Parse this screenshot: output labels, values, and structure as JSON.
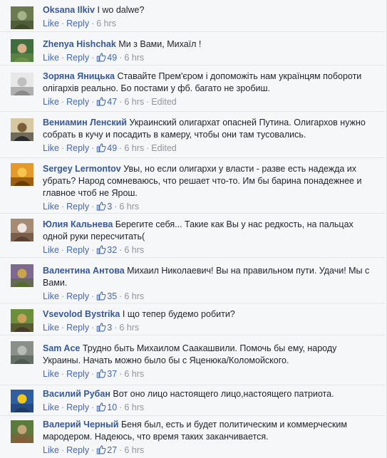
{
  "actions": {
    "like": "Like",
    "reply": "Reply",
    "sep": "·",
    "edited": "Edited"
  },
  "comments": [
    {
      "author": "Oksana Ilkiv",
      "text": "I wo dalwe?",
      "likes": "",
      "time": "6 hrs",
      "edited": false
    },
    {
      "author": "Zhenya Hishchak",
      "text": "Ми з Вами, Михаїл !",
      "likes": "49",
      "time": "6 hrs",
      "edited": false
    },
    {
      "author": "Зоряна Яницька",
      "text": "Ставайте Прем'єром і допоможіть нам українцям побороти олігархів реально. Бо постами у фб. багато не зробиш.",
      "likes": "47",
      "time": "6 hrs",
      "edited": true
    },
    {
      "author": "Вениамин Ленский",
      "text": "Украинский олигархат опасней Путина. Олигархов нужно собрать в кучу и посадить в камеру, чтобы они там тусовались.",
      "likes": "49",
      "time": "6 hrs",
      "edited": true
    },
    {
      "author": "Sergey Lermontov",
      "text": "Увы, но если олигархи у власти - разве есть надежда их убрать? Народ сомневаюсь, что решает что-то. Им бы барина понадежнее и главное чтоб не Ярош.",
      "likes": "3",
      "time": "6 hrs",
      "edited": false
    },
    {
      "author": "Юлия Кальнева",
      "text": "Берегите себя... Такие как Вы у нас редкость, на пальцах одной руки пересчитать(",
      "likes": "32",
      "time": "6 hrs",
      "edited": false
    },
    {
      "author": "Валентина Антова",
      "text": "Михаил Николаевич! Вы на правильном пути. Удачи! Мы с Вами.",
      "likes": "35",
      "time": "6 hrs",
      "edited": false
    },
    {
      "author": "Vsevolod Bystrika",
      "text": "І що тепер будемо робити?",
      "likes": "3",
      "time": "6 hrs",
      "edited": false
    },
    {
      "author": "Sam Ace",
      "text": "Трудно быть Михаилом Саакашвили. Помочь бы ему, народу Украины. Начать можно было бы с Яценюка/Коломойского.",
      "likes": "37",
      "time": "6 hrs",
      "edited": false
    },
    {
      "author": "Василий Рубан",
      "text": "Вот оно лицо настоящего лицо,настоящего патриота.",
      "likes": "10",
      "time": "6 hrs",
      "edited": false
    },
    {
      "author": "Валерий Черный",
      "text": "Беня был, есть и будет политическим и коммерческим мародером. Надеюсь, что время таких заканчивается.",
      "likes": "27",
      "time": "6 hrs",
      "edited": false
    }
  ],
  "colors": {
    "author": "#365899",
    "link": "#4267b2",
    "meta": "#90949c",
    "text": "#1d2129",
    "background": "#f6f7f9"
  },
  "icons": {
    "like": "thumbs-up-icon",
    "avatar": "user-avatar"
  }
}
